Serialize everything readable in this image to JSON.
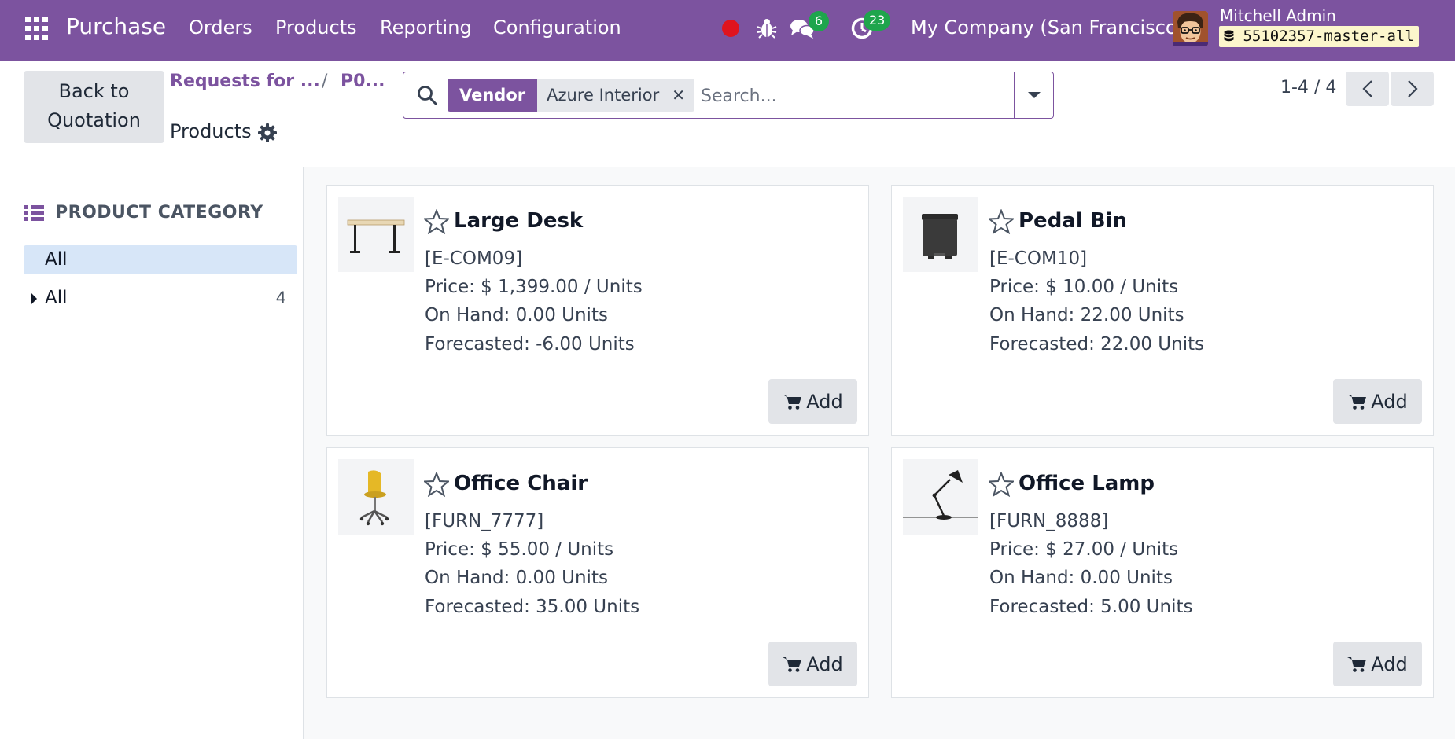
{
  "navbar": {
    "app_name": "Purchase",
    "menus": [
      "Orders",
      "Products",
      "Reporting",
      "Configuration"
    ],
    "messages_count": "6",
    "activities_count": "23",
    "company": "My Company (San Francisco)",
    "user_name": "Mitchell Admin",
    "database": "55102357-master-all",
    "accent_color": "#7c539f"
  },
  "control": {
    "back_button": "Back to Quotation",
    "breadcrumb": [
      "Requests for ...",
      "P0..."
    ],
    "breadcrumb_separator": "/",
    "page_title": "Products",
    "search": {
      "facet_label": "Vendor",
      "facet_value": "Azure Interior",
      "placeholder": "Search..."
    },
    "pager": "1-4 / 4"
  },
  "sidepanel": {
    "title": "PRODUCT CATEGORY",
    "items": [
      {
        "label": "All",
        "selected": true
      },
      {
        "label": "All",
        "count": "4"
      }
    ]
  },
  "products": [
    {
      "name": "Large Desk",
      "code": "[E-COM09]",
      "price": "Price: $ 1,399.00 / Units",
      "on_hand": "On Hand: 0.00 Units",
      "forecasted": "Forecasted: -6.00 Units",
      "add_label": "Add",
      "image": "desk"
    },
    {
      "name": "Pedal Bin",
      "code": "[E-COM10]",
      "price": "Price: $ 10.00 / Units",
      "on_hand": "On Hand: 22.00 Units",
      "forecasted": "Forecasted: 22.00 Units",
      "add_label": "Add",
      "image": "bin"
    },
    {
      "name": "Office Chair",
      "code": "[FURN_7777]",
      "price": "Price: $ 55.00 / Units",
      "on_hand": "On Hand: 0.00 Units",
      "forecasted": "Forecasted: 35.00 Units",
      "add_label": "Add",
      "image": "chair"
    },
    {
      "name": "Office Lamp",
      "code": "[FURN_8888]",
      "price": "Price: $ 27.00 / Units",
      "on_hand": "On Hand: 0.00 Units",
      "forecasted": "Forecasted: 5.00 Units",
      "add_label": "Add",
      "image": "lamp"
    }
  ]
}
